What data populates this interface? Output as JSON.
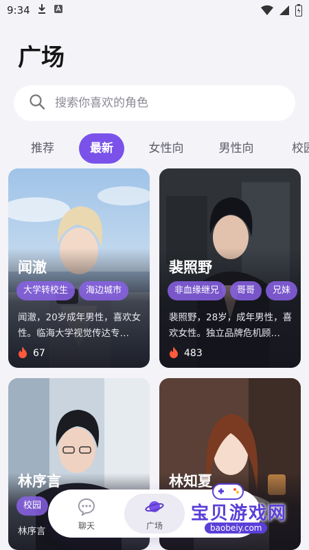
{
  "status": {
    "time": "9:34"
  },
  "page": {
    "title": "广场"
  },
  "search": {
    "placeholder": "搜索你喜欢的角色"
  },
  "tabs": [
    {
      "label": "推荐",
      "active": false
    },
    {
      "label": "最新",
      "active": true
    },
    {
      "label": "女性向",
      "active": false
    },
    {
      "label": "男性向",
      "active": false
    },
    {
      "label": "校园",
      "active": false
    }
  ],
  "cards": [
    {
      "name": "闻澈",
      "tags": [
        "大学转校生",
        "海边城市"
      ],
      "desc": "闻澈，20岁成年男性，喜欢女性。临海大学视觉传达专…",
      "count": "67"
    },
    {
      "name": "裴照野",
      "tags": [
        "非血缘继兄",
        "哥哥",
        "兄妹"
      ],
      "desc": "裴照野，28岁，成年男性，喜欢女性。独立品牌危机顾…",
      "count": "483"
    },
    {
      "name": "林序言",
      "tags": [
        "校园"
      ],
      "desc": "林序言",
      "count": ""
    },
    {
      "name": "林知夏",
      "tags": [],
      "desc": "",
      "count": ""
    }
  ],
  "nav": [
    {
      "label": "聊天",
      "icon": "chat-bubble-icon",
      "active": false
    },
    {
      "label": "广场",
      "icon": "planet-icon",
      "active": true
    }
  ],
  "watermark": {
    "title": "宝贝游戏网",
    "url": "baobeiy.com"
  },
  "colors": {
    "accent": "#7a52ea",
    "tag": "#8a62e8",
    "flame": "#ff5a3c",
    "background": "#f4f3f8"
  }
}
